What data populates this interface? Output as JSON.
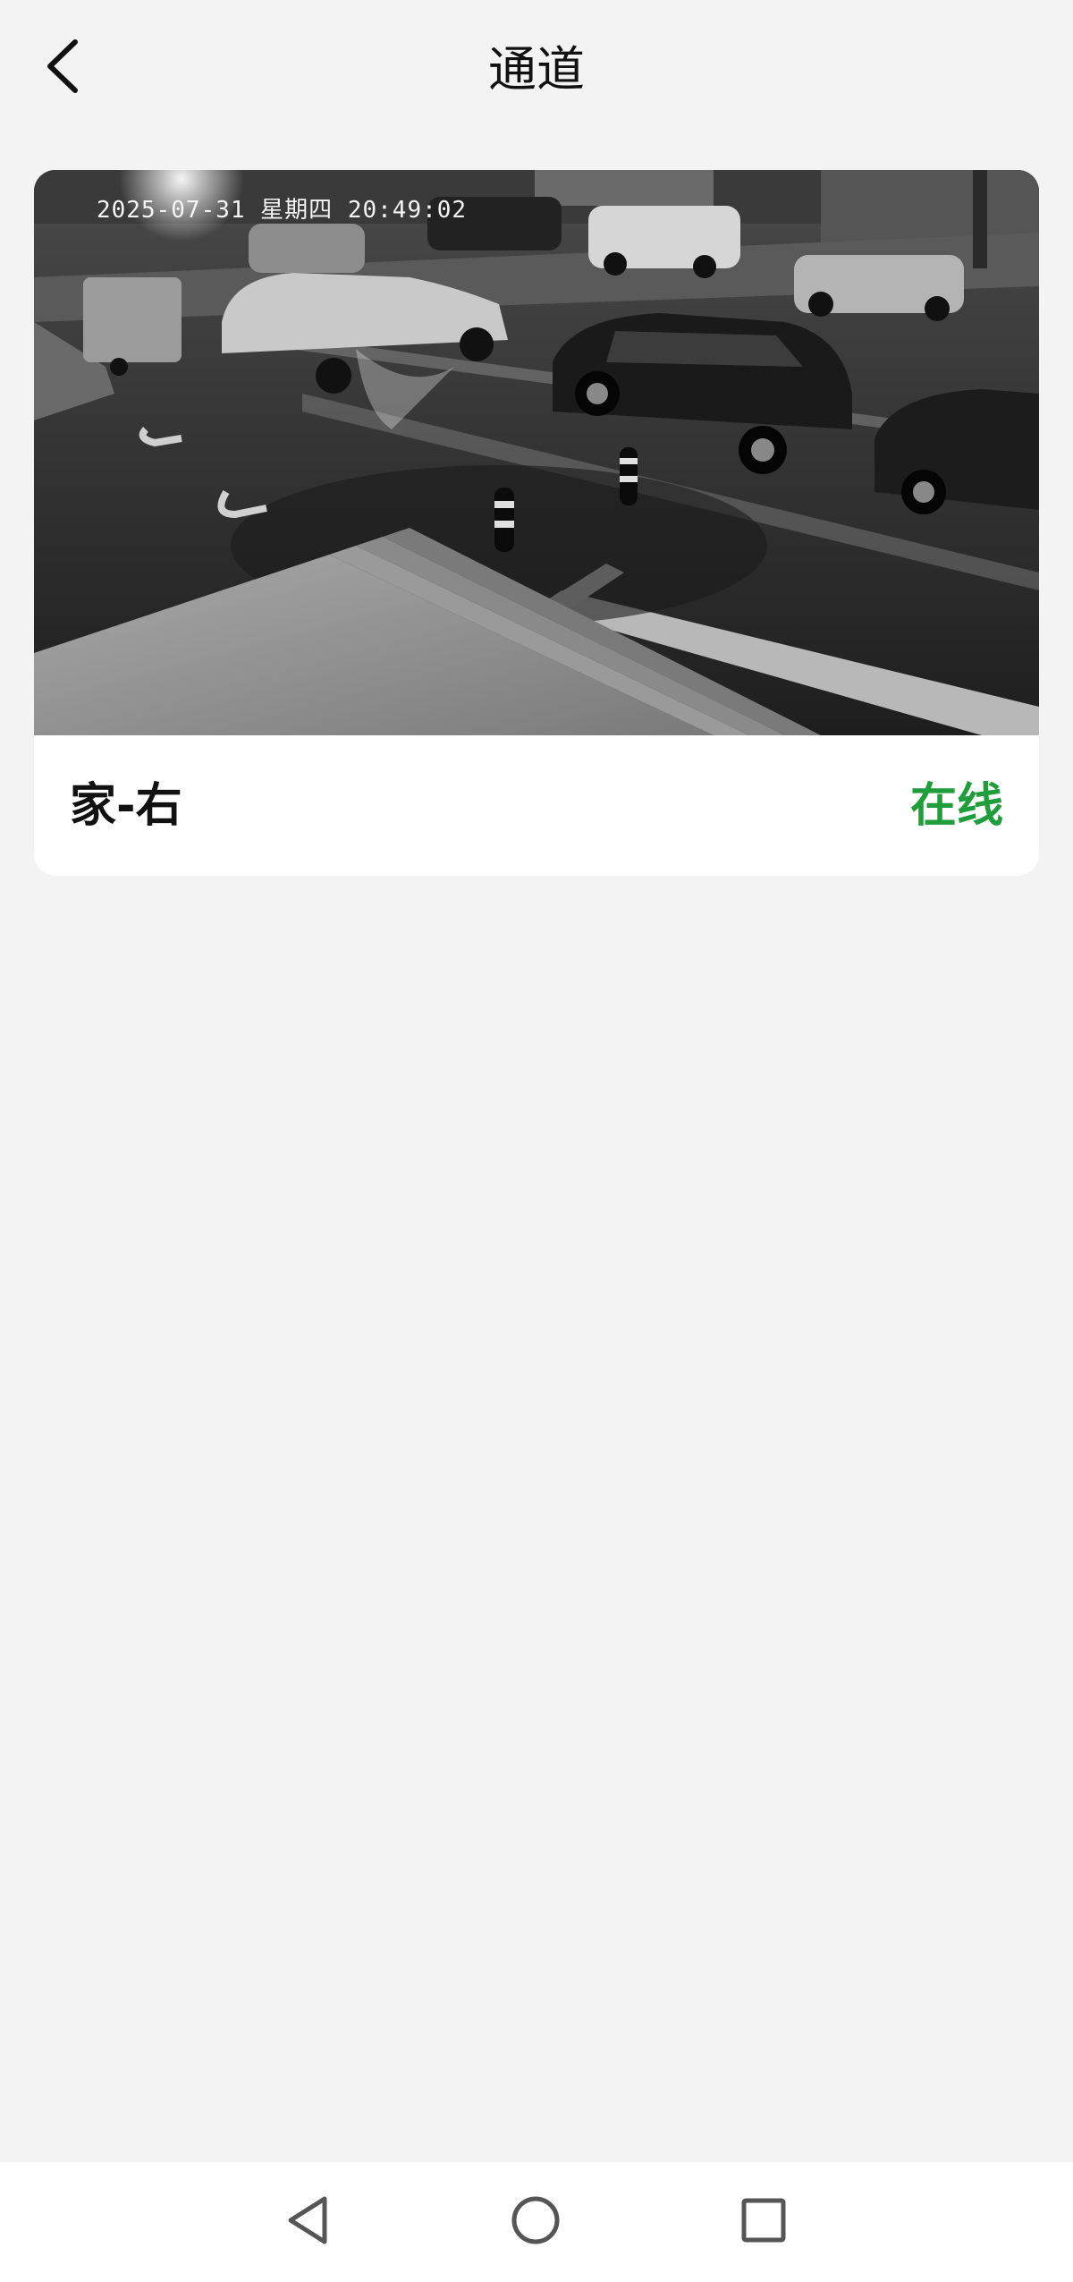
{
  "header": {
    "title": "通道",
    "back_icon": "chevron-left-icon"
  },
  "channel": {
    "name": "家-右",
    "status": "在线",
    "status_color": "#1f9d3a",
    "preview": {
      "timestamp": "2025-07-31 星期四 20:49:02"
    }
  },
  "nav": {
    "back_icon": "triangle-back-icon",
    "home_icon": "circle-home-icon",
    "recents_icon": "square-recents-icon"
  }
}
